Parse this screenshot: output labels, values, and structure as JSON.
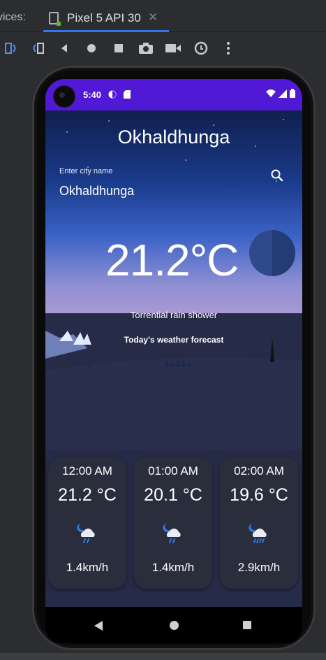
{
  "ide": {
    "devices_label": "vices:",
    "device_tab": "Pixel 5 API 30",
    "tab_close": "✕",
    "toolbar_icons": [
      "rotate-left-icon",
      "rotate-right-icon",
      "back-icon",
      "home-icon",
      "overview-icon",
      "camera-icon",
      "record-icon",
      "replay-icon",
      "more-icon"
    ]
  },
  "status": {
    "time": "5:40"
  },
  "app": {
    "city_title": "Okhaldhunga",
    "input_label": "Enter city name",
    "input_value": "Okhaldhunga",
    "temperature": "21.2°C",
    "condition": "Torrential rain shower",
    "forecast_title": "Today's weather forecast"
  },
  "forecast": [
    {
      "time": "12:00 AM",
      "temp": "21.2 °C",
      "wind": "1.4km/h",
      "icon": "night-rain-icon"
    },
    {
      "time": "01:00 AM",
      "temp": "20.1 °C",
      "wind": "1.4km/h",
      "icon": "night-rain-icon"
    },
    {
      "time": "02:00 AM",
      "temp": "19.6 °C",
      "wind": "2.9km/h",
      "icon": "night-heavy-rain-icon"
    }
  ],
  "colors": {
    "status_bar": "#5118d6",
    "background": "#262b47",
    "card": "#2a2d3c",
    "ide_accent": "#3574f0"
  }
}
